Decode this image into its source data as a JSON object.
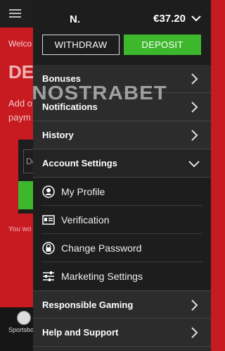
{
  "background": {
    "welcome_text": "Welco",
    "heading_text": "DE",
    "add_text_line1": "Add o",
    "add_text_line2": "paym",
    "input_text": "De",
    "footer_text": "You wo",
    "bottom_nav_label": "Sportsbo"
  },
  "header": {
    "username": "N.",
    "balance": "€37.20",
    "withdraw_label": "WITHDRAW",
    "deposit_label": "DEPOSIT"
  },
  "menu": [
    {
      "label": "Bonuses"
    },
    {
      "label": "Notifications"
    },
    {
      "label": "History"
    },
    {
      "label": "Account Settings"
    }
  ],
  "account_settings": [
    {
      "label": "My Profile",
      "icon": "profile-icon"
    },
    {
      "label": "Verification",
      "icon": "id-card-icon"
    },
    {
      "label": "Change Password",
      "icon": "lock-icon"
    },
    {
      "label": "Marketing Settings",
      "icon": "sliders-icon"
    }
  ],
  "menu_bottom": [
    {
      "label": "Responsible Gaming"
    },
    {
      "label": "Help and Support"
    }
  ],
  "watermark": "NOSTRABET",
  "colors": {
    "accent": "#3db82c",
    "brand_red": "#c81b21",
    "drawer": "#2a2a2a"
  }
}
